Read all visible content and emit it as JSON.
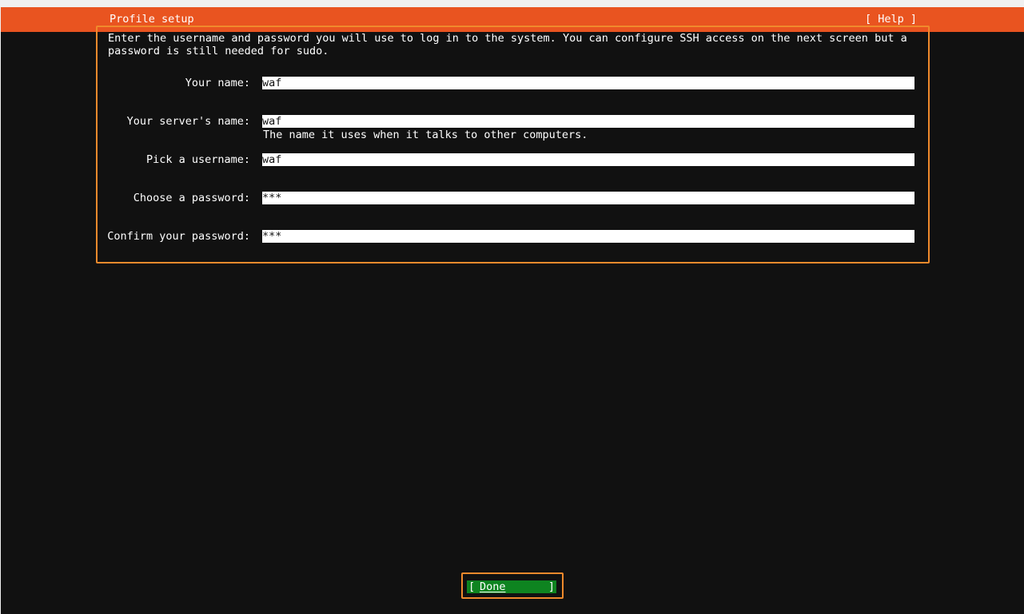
{
  "window": {
    "title": "Profile setup",
    "help_label": "[ Help ]"
  },
  "form": {
    "intro": "Enter the username and password you will use to log in to the system. You can configure SSH access on the next screen but a password is still needed for sudo.",
    "fields": [
      {
        "label": "Your name:",
        "value": "waf"
      },
      {
        "label": "Your server's name:",
        "value": "waf",
        "hint": "The name it uses when it talks to other computers."
      },
      {
        "label": "Pick a username:",
        "value": "waf"
      },
      {
        "label": "Choose a password:",
        "value": "***"
      },
      {
        "label": "Confirm your password:",
        "value": "***"
      }
    ]
  },
  "footer": {
    "done_bracket_left": "[",
    "done_label": "Done",
    "done_bracket_right": "]"
  },
  "colors": {
    "titlebar": "#e95420",
    "focus_border": "#f08a2c",
    "done_button": "#0e8420",
    "background": "#111111"
  }
}
